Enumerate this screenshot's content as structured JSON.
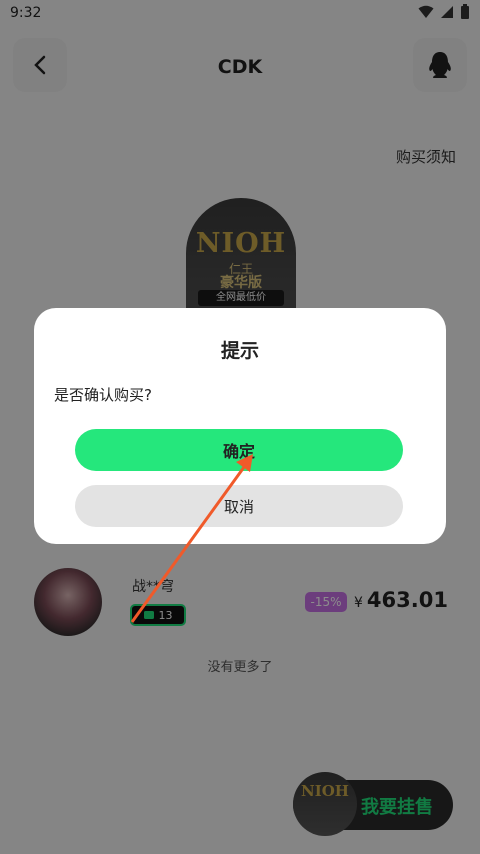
{
  "status_bar": {
    "time": "9:32"
  },
  "header": {
    "title": "CDK"
  },
  "purchase_notice": "购买须知",
  "game": {
    "logo": "NIOH",
    "subtitle": "仁王",
    "edition": "豪华版",
    "tag": "全网最低价"
  },
  "seller": {
    "name": "战**穹",
    "level": "13",
    "discount": "-15%",
    "currency": "¥",
    "price": "463.01"
  },
  "no_more": "没有更多了",
  "sell_button": {
    "label": "我要挂售",
    "thumb_logo": "NIOH"
  },
  "dialog": {
    "title": "提示",
    "message": "是否确认购买?",
    "confirm_label": "确定",
    "cancel_label": "取消"
  },
  "colors": {
    "accent_green": "#25e77c",
    "discount_purple": "#c56fe3",
    "annotation_arrow": "#f05a2a"
  }
}
